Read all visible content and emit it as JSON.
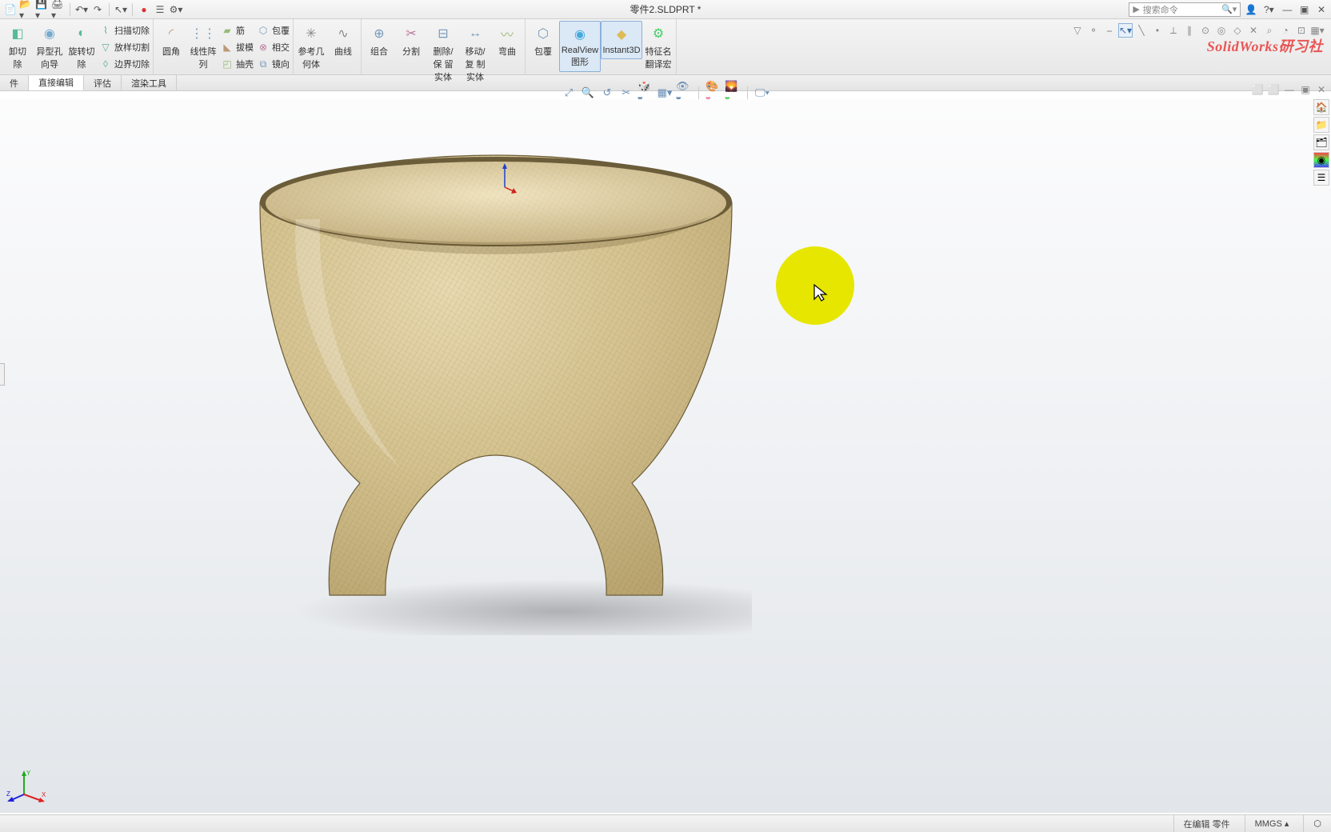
{
  "title": "零件2.SLDPRT *",
  "search_placeholder": "搜索命令",
  "watermark": "SolidWorks研习社",
  "ribbon": {
    "g1": {
      "b1": "卸切\n除",
      "b2": "异型孔\n向导",
      "b3": "旋转切\n除",
      "s1": "扫描切除",
      "s2": "放样切割",
      "s3": "边界切除"
    },
    "g2": {
      "b1": "圆角",
      "b2": "线性阵\n列",
      "s1": "筋",
      "s2": "拔模",
      "s3": "抽壳",
      "s4": "包覆",
      "s5": "相交",
      "s6": "镜向"
    },
    "g3": {
      "b1": "参考几\n何体",
      "b2": "曲线"
    },
    "g4": {
      "b1": "组合",
      "b2": "分割",
      "b3": "删除/保\n留实体",
      "b4": "移动/复\n制实体",
      "b5": "弯曲"
    },
    "g5": {
      "b1": "包覆",
      "b2": "RealView\n图形",
      "b3": "Instant3D",
      "b4": "特征名\n翻译宏"
    }
  },
  "tabs": {
    "t1": "件",
    "t2": "直接编辑",
    "t3": "评估",
    "t4": "渲染工具"
  },
  "status": {
    "mode": "在编辑 零件",
    "units": "MMGS"
  },
  "right_items": [
    "home-icon",
    "file-icon",
    "layers-icon",
    "globe-icon",
    "settings-icon"
  ],
  "colors": {
    "accent": "#e95555",
    "highlight": "#e6e600"
  }
}
